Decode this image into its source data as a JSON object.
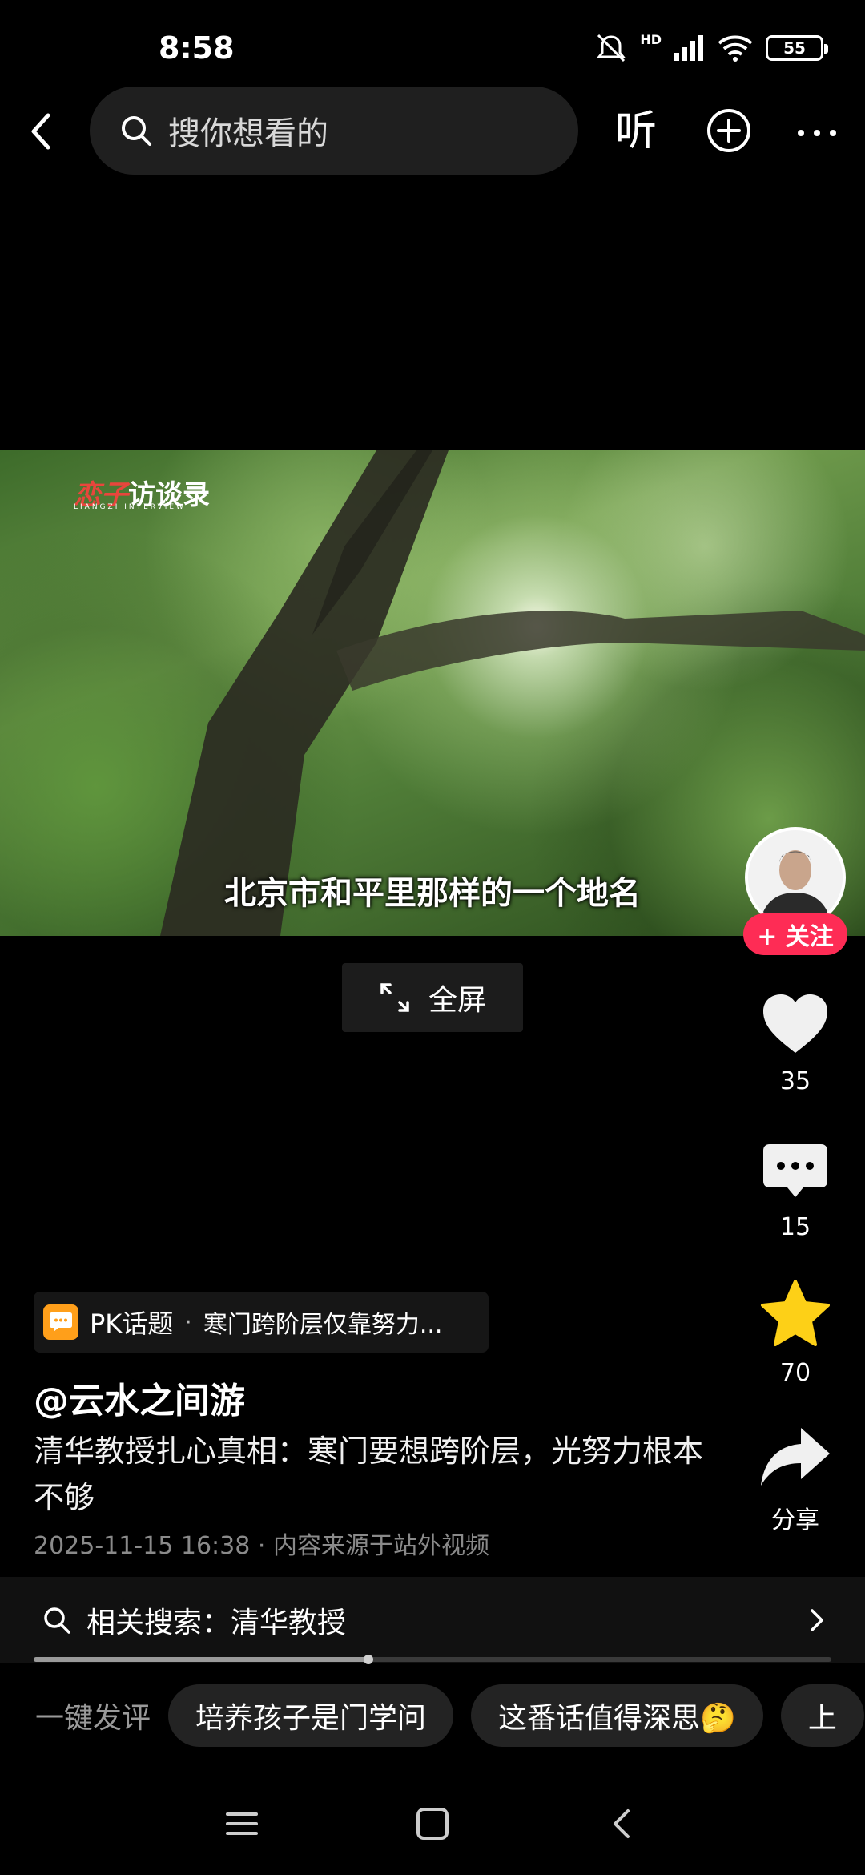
{
  "status_bar": {
    "time": "8:58",
    "network": "HD",
    "battery": "55"
  },
  "top_bar": {
    "search_placeholder": "搜你想看的",
    "listen_label": "听"
  },
  "video": {
    "logo_text_red": "恋子",
    "logo_text_white": "访谈录",
    "logo_subtext": "LIANGZI INTERVIEW",
    "subtitle": "北京市和平里那样的一个地名"
  },
  "follow_label": "+ 关注",
  "fullscreen_label": "全屏",
  "rail": {
    "likes": "35",
    "comments": "15",
    "favorites": "70",
    "share_label": "分享"
  },
  "topic": {
    "label": "PK话题",
    "separator": "·",
    "title": "寒门跨阶层仅靠努力..."
  },
  "author": "@云水之间游",
  "description": "清华教授扎心真相：寒门要想跨阶层，光努力根本不够",
  "meta": "2025-11-15 16:38 · 内容来源于站外视频",
  "related_search": "相关搜索：清华教授",
  "progress": {
    "fraction": 0.42
  },
  "comment_bar": {
    "label": "一键发评",
    "chips": [
      "培养孩子是门学问",
      "这番话值得深思🤔",
      "上"
    ]
  },
  "colors": {
    "follow": "#fe2c55",
    "favorite_star": "#fdd017",
    "topic_icon": "#ff9f1a"
  }
}
